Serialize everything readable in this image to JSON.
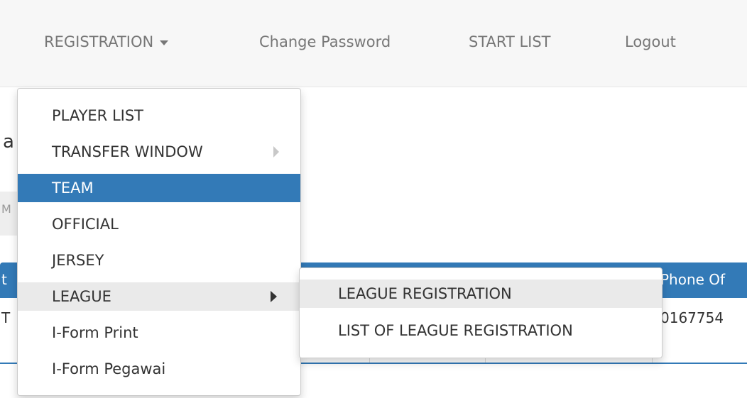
{
  "navbar": {
    "registration_label": "REGISTRATION",
    "change_password_label": "Change Password",
    "start_list_label": "START LIST",
    "logout_label": "Logout"
  },
  "dropdown": {
    "items": [
      {
        "label": "PLAYER LIST"
      },
      {
        "label": "TRANSFER WINDOW"
      },
      {
        "label": "TEAM"
      },
      {
        "label": "OFFICIAL"
      },
      {
        "label": "JERSEY"
      },
      {
        "label": "LEAGUE"
      },
      {
        "label": "I-Form Print"
      },
      {
        "label": "I-Form Pegawai"
      }
    ],
    "active_index": 2
  },
  "submenu": {
    "items": [
      {
        "label": "LEAGUE REGISTRATION"
      },
      {
        "label": "LIST OF LEAGUE REGISTRATION"
      }
    ]
  },
  "background": {
    "fragment_a": "a",
    "fragment_m": "M",
    "fragment_t_header": "t",
    "fragment_t_row": "T",
    "table_header_phone": "Phone Of",
    "table_cell_phone": "0167754"
  },
  "colors": {
    "navbar_bg": "#f7f7f7",
    "active_blue": "#337ab7",
    "hover_gray": "#eaeaea"
  }
}
